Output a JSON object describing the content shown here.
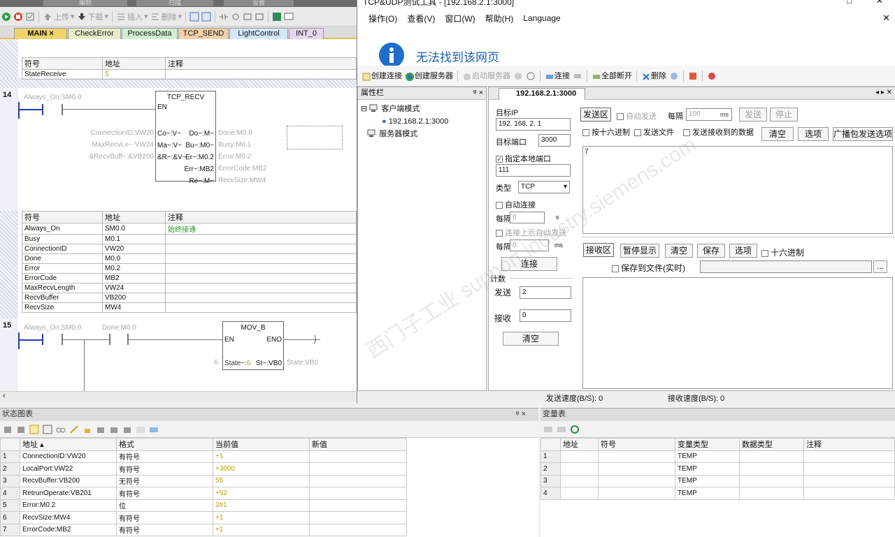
{
  "left_app": {
    "topbar_labels": [
      "编制",
      "扫描",
      "设置"
    ],
    "toolbar": {
      "upload": "上传",
      "download": "下载",
      "insert": "插入",
      "delete": "删除"
    },
    "tabs": [
      "MAIN",
      "CheckError",
      "ProcessData",
      "TCP_SEND",
      "LightControl",
      "INT_0"
    ],
    "symbol_table_1": {
      "headers": [
        "符号",
        "地址",
        "注释"
      ],
      "rows": [
        [
          "StateReceive",
          "5",
          ""
        ]
      ]
    },
    "network_14": {
      "number": "14",
      "contact_label": "Always_On:SM0.0",
      "block_name": "TCP_RECV",
      "en": "EN",
      "inputs": [
        "ConnectionID:VW20",
        "MaxRecvLe~:VW24",
        "&RecvBuff~:&VB200"
      ],
      "input_pins": [
        "Co~:V~",
        "Ma~:V~",
        "&R~:&V~"
      ],
      "output_pins": [
        "Do~:M~",
        "Bu~:M0~",
        "Er~:M0.2",
        "Err~:MB2",
        "Re~:M~"
      ],
      "outputs": [
        "Done:M0.0",
        "Busy:M0.1",
        "Error:M0.2",
        "ErrorCode:MB2",
        "RecvSize:MW4"
      ]
    },
    "symbol_table_2": {
      "headers": [
        "符号",
        "地址",
        "注释"
      ],
      "rows": [
        [
          "Always_On",
          "SM0.0",
          "始终接通"
        ],
        [
          "Busy",
          "M0.1",
          ""
        ],
        [
          "ConnectionID",
          "VW20",
          ""
        ],
        [
          "Done",
          "M0.0",
          ""
        ],
        [
          "Error",
          "M0.2",
          ""
        ],
        [
          "ErrorCode",
          "MB2",
          ""
        ],
        [
          "MaxRecvLength",
          "VW24",
          ""
        ],
        [
          "RecvBuffer",
          "VB200",
          ""
        ],
        [
          "RecvSize",
          "MW4",
          ""
        ]
      ]
    },
    "network_15": {
      "number": "15",
      "contact1": "Always_On:SM0.0",
      "contact2": "Done:M0.0",
      "block_name": "MOV_B",
      "en": "EN",
      "eno": "ENO",
      "in_value": "6",
      "in_pin": "State~:6",
      "out_pin": "St~:VB0",
      "out_label": "State:VB0"
    }
  },
  "tcp_window": {
    "title": "TCP&UDP测试工具 - [192.168.2.1:3000]",
    "menu": [
      "操作(O)",
      "查看(V)",
      "窗口(W)",
      "帮助(H)",
      "Language"
    ],
    "browser_error": "无法找到该网页",
    "toolbar": [
      "创建连接",
      "创建服务器",
      "启动服务器",
      "连接",
      "全部断开",
      "删除"
    ],
    "property_bar": {
      "title": "属性栏",
      "pin": "ᵠ ×",
      "client_mode": "客户端模式",
      "client_item": "192.168.2.1:3000",
      "server_mode": "服务器模式"
    },
    "tab_label": "192.168.2.1:3000",
    "target_ip_label": "目标IP",
    "target_ip": "192. 168. 2. 1",
    "target_port_label": "目标端口",
    "target_port": "3000",
    "local_port_check": "指定本地端口",
    "local_port": "111",
    "type_label": "类型",
    "type_value": "TCP",
    "auto_connect": "自动连接",
    "interval_label": "每隔",
    "interval_1": "0",
    "unit_s": "s",
    "auto_send_after": "连接上后自动发送",
    "interval_2": "0",
    "unit_ms": "ms",
    "connect_button": "连接",
    "count_label": "计数",
    "send_label": "发送",
    "send_count": "2",
    "recv_label": "接收",
    "recv_count": "0",
    "clear_button": "清空",
    "send_area": {
      "label": "发送区",
      "auto_send": "自动发送",
      "every": "每隔",
      "period": "100",
      "ms": "ms",
      "send_btn": "发送",
      "stop_btn": "停止",
      "hex_send": "按十六进制",
      "send_file": "发送文件",
      "send_received": "发送接收到的数据",
      "clear": "清空",
      "options": "选项",
      "broadcast": "广播包发送选项",
      "content": "7"
    },
    "recv_area": {
      "label": "接收区",
      "pause": "暂停显示",
      "clear": "清空",
      "save": "保存",
      "options": "选项",
      "hex": "十六进制",
      "save_file": "保存到文件(实时)",
      "browse": "..."
    },
    "status": {
      "send_speed": "发送速度(B/S): 0",
      "recv_speed": "接收速度(B/S): 0"
    }
  },
  "status_chart": {
    "title": "状态图表",
    "pin": "ᵠ ×",
    "headers": [
      "地址",
      "格式",
      "当前值",
      "新值"
    ],
    "rows": [
      [
        "1",
        "ConnectionID:VW20",
        "有符号",
        "+1",
        ""
      ],
      [
        "2",
        "LocalPort:VW22",
        "有符号",
        "+3000",
        ""
      ],
      [
        "3",
        "RecvBuffer:VB200",
        "无符号",
        "55",
        ""
      ],
      [
        "4",
        "RetrunOperate:VB201",
        "有符号",
        "+52",
        ""
      ],
      [
        "5",
        "Error:M0.2",
        "位",
        "2#1",
        ""
      ],
      [
        "6",
        "RecvSize:MW4",
        "有符号",
        "+1",
        ""
      ],
      [
        "7",
        "ErrorCode:MB2",
        "有符号",
        "+1",
        ""
      ]
    ]
  },
  "var_table": {
    "title": "变量表",
    "headers": [
      "地址",
      "符号",
      "变量类型",
      "数据类型",
      "注释"
    ],
    "rows": [
      [
        "1",
        "",
        "",
        "TEMP",
        "",
        ""
      ],
      [
        "2",
        "",
        "",
        "TEMP",
        "",
        ""
      ],
      [
        "3",
        "",
        "",
        "TEMP",
        "",
        ""
      ],
      [
        "4",
        "",
        "",
        "TEMP",
        "",
        ""
      ]
    ]
  },
  "watermark": "西门子工业 support.industry.siemens.com"
}
